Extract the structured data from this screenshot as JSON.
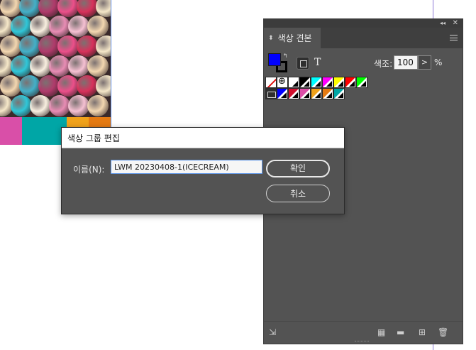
{
  "panel": {
    "tab_label": "색상 견본",
    "tint_label": "색조:",
    "tint_value": "100",
    "tint_arrow": ">",
    "tint_unit": "%",
    "text_toggle": "T",
    "fill_color": "#0000ff",
    "stroke_color": "#000000",
    "swatch_rows": [
      [
        {
          "name": "none-swatch",
          "type": "none"
        },
        {
          "name": "registration-swatch",
          "type": "registration"
        },
        {
          "name": "paper-swatch",
          "color": "#ffffff"
        },
        {
          "name": "black-swatch",
          "color": "#000000"
        },
        {
          "name": "cyan-swatch",
          "color": "#00ffff"
        },
        {
          "name": "magenta-swatch",
          "color": "#ff00ff"
        },
        {
          "name": "yellow-swatch",
          "color": "#ffff00"
        },
        {
          "name": "red-swatch",
          "color": "#ff0000"
        },
        {
          "name": "green-swatch",
          "color": "#00ff00"
        }
      ],
      [
        {
          "name": "color-group-folder",
          "type": "folder"
        },
        {
          "name": "blue-swatch",
          "color": "#0000ff"
        },
        {
          "name": "crimson-swatch",
          "color": "#d1102e"
        },
        {
          "name": "pink-swatch",
          "color": "#dc4fa7"
        },
        {
          "name": "orange-swatch",
          "color": "#f0a21b"
        },
        {
          "name": "dark-orange-swatch",
          "color": "#e47a12"
        },
        {
          "name": "teal-swatch",
          "color": "#00a6a6"
        }
      ]
    ]
  },
  "dialog": {
    "title": "색상 그룹 편집",
    "name_label": "이름(N):",
    "name_value": "LWM 20230408-1(ICECREAM)",
    "ok_label": "확인",
    "cancel_label": "취소"
  },
  "document": {
    "stripe_colors": [
      "#d94fa8",
      "#00a6a6",
      "#00a6a6",
      "#f0a21b",
      "#e47a12"
    ]
  }
}
